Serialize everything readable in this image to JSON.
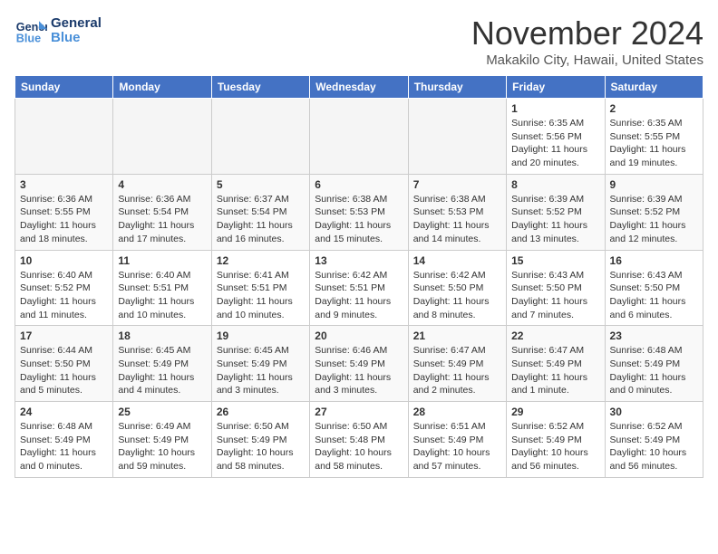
{
  "header": {
    "logo_line1": "General",
    "logo_line2": "Blue",
    "month": "November 2024",
    "location": "Makakilo City, Hawaii, United States"
  },
  "weekdays": [
    "Sunday",
    "Monday",
    "Tuesday",
    "Wednesday",
    "Thursday",
    "Friday",
    "Saturday"
  ],
  "weeks": [
    [
      {
        "day": "",
        "info": ""
      },
      {
        "day": "",
        "info": ""
      },
      {
        "day": "",
        "info": ""
      },
      {
        "day": "",
        "info": ""
      },
      {
        "day": "",
        "info": ""
      },
      {
        "day": "1",
        "info": "Sunrise: 6:35 AM\nSunset: 5:56 PM\nDaylight: 11 hours and 20 minutes."
      },
      {
        "day": "2",
        "info": "Sunrise: 6:35 AM\nSunset: 5:55 PM\nDaylight: 11 hours and 19 minutes."
      }
    ],
    [
      {
        "day": "3",
        "info": "Sunrise: 6:36 AM\nSunset: 5:55 PM\nDaylight: 11 hours and 18 minutes."
      },
      {
        "day": "4",
        "info": "Sunrise: 6:36 AM\nSunset: 5:54 PM\nDaylight: 11 hours and 17 minutes."
      },
      {
        "day": "5",
        "info": "Sunrise: 6:37 AM\nSunset: 5:54 PM\nDaylight: 11 hours and 16 minutes."
      },
      {
        "day": "6",
        "info": "Sunrise: 6:38 AM\nSunset: 5:53 PM\nDaylight: 11 hours and 15 minutes."
      },
      {
        "day": "7",
        "info": "Sunrise: 6:38 AM\nSunset: 5:53 PM\nDaylight: 11 hours and 14 minutes."
      },
      {
        "day": "8",
        "info": "Sunrise: 6:39 AM\nSunset: 5:52 PM\nDaylight: 11 hours and 13 minutes."
      },
      {
        "day": "9",
        "info": "Sunrise: 6:39 AM\nSunset: 5:52 PM\nDaylight: 11 hours and 12 minutes."
      }
    ],
    [
      {
        "day": "10",
        "info": "Sunrise: 6:40 AM\nSunset: 5:52 PM\nDaylight: 11 hours and 11 minutes."
      },
      {
        "day": "11",
        "info": "Sunrise: 6:40 AM\nSunset: 5:51 PM\nDaylight: 11 hours and 10 minutes."
      },
      {
        "day": "12",
        "info": "Sunrise: 6:41 AM\nSunset: 5:51 PM\nDaylight: 11 hours and 10 minutes."
      },
      {
        "day": "13",
        "info": "Sunrise: 6:42 AM\nSunset: 5:51 PM\nDaylight: 11 hours and 9 minutes."
      },
      {
        "day": "14",
        "info": "Sunrise: 6:42 AM\nSunset: 5:50 PM\nDaylight: 11 hours and 8 minutes."
      },
      {
        "day": "15",
        "info": "Sunrise: 6:43 AM\nSunset: 5:50 PM\nDaylight: 11 hours and 7 minutes."
      },
      {
        "day": "16",
        "info": "Sunrise: 6:43 AM\nSunset: 5:50 PM\nDaylight: 11 hours and 6 minutes."
      }
    ],
    [
      {
        "day": "17",
        "info": "Sunrise: 6:44 AM\nSunset: 5:50 PM\nDaylight: 11 hours and 5 minutes."
      },
      {
        "day": "18",
        "info": "Sunrise: 6:45 AM\nSunset: 5:49 PM\nDaylight: 11 hours and 4 minutes."
      },
      {
        "day": "19",
        "info": "Sunrise: 6:45 AM\nSunset: 5:49 PM\nDaylight: 11 hours and 3 minutes."
      },
      {
        "day": "20",
        "info": "Sunrise: 6:46 AM\nSunset: 5:49 PM\nDaylight: 11 hours and 3 minutes."
      },
      {
        "day": "21",
        "info": "Sunrise: 6:47 AM\nSunset: 5:49 PM\nDaylight: 11 hours and 2 minutes."
      },
      {
        "day": "22",
        "info": "Sunrise: 6:47 AM\nSunset: 5:49 PM\nDaylight: 11 hours and 1 minute."
      },
      {
        "day": "23",
        "info": "Sunrise: 6:48 AM\nSunset: 5:49 PM\nDaylight: 11 hours and 0 minutes."
      }
    ],
    [
      {
        "day": "24",
        "info": "Sunrise: 6:48 AM\nSunset: 5:49 PM\nDaylight: 11 hours and 0 minutes."
      },
      {
        "day": "25",
        "info": "Sunrise: 6:49 AM\nSunset: 5:49 PM\nDaylight: 10 hours and 59 minutes."
      },
      {
        "day": "26",
        "info": "Sunrise: 6:50 AM\nSunset: 5:49 PM\nDaylight: 10 hours and 58 minutes."
      },
      {
        "day": "27",
        "info": "Sunrise: 6:50 AM\nSunset: 5:48 PM\nDaylight: 10 hours and 58 minutes."
      },
      {
        "day": "28",
        "info": "Sunrise: 6:51 AM\nSunset: 5:49 PM\nDaylight: 10 hours and 57 minutes."
      },
      {
        "day": "29",
        "info": "Sunrise: 6:52 AM\nSunset: 5:49 PM\nDaylight: 10 hours and 56 minutes."
      },
      {
        "day": "30",
        "info": "Sunrise: 6:52 AM\nSunset: 5:49 PM\nDaylight: 10 hours and 56 minutes."
      }
    ]
  ]
}
